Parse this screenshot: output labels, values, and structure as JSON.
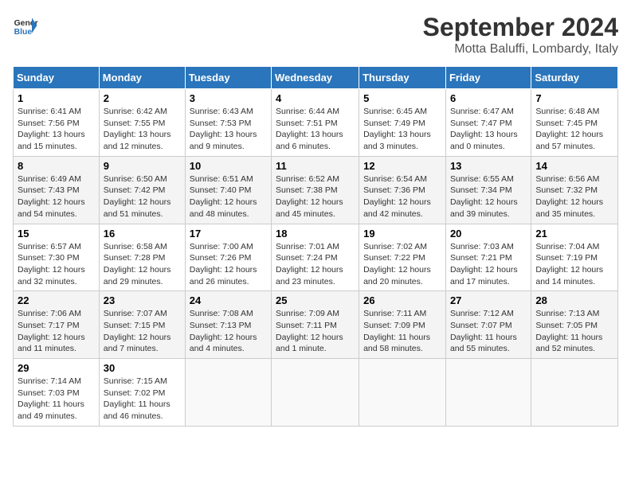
{
  "header": {
    "logo_line1": "General",
    "logo_line2": "Blue",
    "month": "September 2024",
    "location": "Motta Baluffi, Lombardy, Italy"
  },
  "columns": [
    "Sunday",
    "Monday",
    "Tuesday",
    "Wednesday",
    "Thursday",
    "Friday",
    "Saturday"
  ],
  "weeks": [
    [
      {
        "day": "1",
        "info": "Sunrise: 6:41 AM\nSunset: 7:56 PM\nDaylight: 13 hours\nand 15 minutes."
      },
      {
        "day": "2",
        "info": "Sunrise: 6:42 AM\nSunset: 7:55 PM\nDaylight: 13 hours\nand 12 minutes."
      },
      {
        "day": "3",
        "info": "Sunrise: 6:43 AM\nSunset: 7:53 PM\nDaylight: 13 hours\nand 9 minutes."
      },
      {
        "day": "4",
        "info": "Sunrise: 6:44 AM\nSunset: 7:51 PM\nDaylight: 13 hours\nand 6 minutes."
      },
      {
        "day": "5",
        "info": "Sunrise: 6:45 AM\nSunset: 7:49 PM\nDaylight: 13 hours\nand 3 minutes."
      },
      {
        "day": "6",
        "info": "Sunrise: 6:47 AM\nSunset: 7:47 PM\nDaylight: 13 hours\nand 0 minutes."
      },
      {
        "day": "7",
        "info": "Sunrise: 6:48 AM\nSunset: 7:45 PM\nDaylight: 12 hours\nand 57 minutes."
      }
    ],
    [
      {
        "day": "8",
        "info": "Sunrise: 6:49 AM\nSunset: 7:43 PM\nDaylight: 12 hours\nand 54 minutes."
      },
      {
        "day": "9",
        "info": "Sunrise: 6:50 AM\nSunset: 7:42 PM\nDaylight: 12 hours\nand 51 minutes."
      },
      {
        "day": "10",
        "info": "Sunrise: 6:51 AM\nSunset: 7:40 PM\nDaylight: 12 hours\nand 48 minutes."
      },
      {
        "day": "11",
        "info": "Sunrise: 6:52 AM\nSunset: 7:38 PM\nDaylight: 12 hours\nand 45 minutes."
      },
      {
        "day": "12",
        "info": "Sunrise: 6:54 AM\nSunset: 7:36 PM\nDaylight: 12 hours\nand 42 minutes."
      },
      {
        "day": "13",
        "info": "Sunrise: 6:55 AM\nSunset: 7:34 PM\nDaylight: 12 hours\nand 39 minutes."
      },
      {
        "day": "14",
        "info": "Sunrise: 6:56 AM\nSunset: 7:32 PM\nDaylight: 12 hours\nand 35 minutes."
      }
    ],
    [
      {
        "day": "15",
        "info": "Sunrise: 6:57 AM\nSunset: 7:30 PM\nDaylight: 12 hours\nand 32 minutes."
      },
      {
        "day": "16",
        "info": "Sunrise: 6:58 AM\nSunset: 7:28 PM\nDaylight: 12 hours\nand 29 minutes."
      },
      {
        "day": "17",
        "info": "Sunrise: 7:00 AM\nSunset: 7:26 PM\nDaylight: 12 hours\nand 26 minutes."
      },
      {
        "day": "18",
        "info": "Sunrise: 7:01 AM\nSunset: 7:24 PM\nDaylight: 12 hours\nand 23 minutes."
      },
      {
        "day": "19",
        "info": "Sunrise: 7:02 AM\nSunset: 7:22 PM\nDaylight: 12 hours\nand 20 minutes."
      },
      {
        "day": "20",
        "info": "Sunrise: 7:03 AM\nSunset: 7:21 PM\nDaylight: 12 hours\nand 17 minutes."
      },
      {
        "day": "21",
        "info": "Sunrise: 7:04 AM\nSunset: 7:19 PM\nDaylight: 12 hours\nand 14 minutes."
      }
    ],
    [
      {
        "day": "22",
        "info": "Sunrise: 7:06 AM\nSunset: 7:17 PM\nDaylight: 12 hours\nand 11 minutes."
      },
      {
        "day": "23",
        "info": "Sunrise: 7:07 AM\nSunset: 7:15 PM\nDaylight: 12 hours\nand 7 minutes."
      },
      {
        "day": "24",
        "info": "Sunrise: 7:08 AM\nSunset: 7:13 PM\nDaylight: 12 hours\nand 4 minutes."
      },
      {
        "day": "25",
        "info": "Sunrise: 7:09 AM\nSunset: 7:11 PM\nDaylight: 12 hours\nand 1 minute."
      },
      {
        "day": "26",
        "info": "Sunrise: 7:11 AM\nSunset: 7:09 PM\nDaylight: 11 hours\nand 58 minutes."
      },
      {
        "day": "27",
        "info": "Sunrise: 7:12 AM\nSunset: 7:07 PM\nDaylight: 11 hours\nand 55 minutes."
      },
      {
        "day": "28",
        "info": "Sunrise: 7:13 AM\nSunset: 7:05 PM\nDaylight: 11 hours\nand 52 minutes."
      }
    ],
    [
      {
        "day": "29",
        "info": "Sunrise: 7:14 AM\nSunset: 7:03 PM\nDaylight: 11 hours\nand 49 minutes."
      },
      {
        "day": "30",
        "info": "Sunrise: 7:15 AM\nSunset: 7:02 PM\nDaylight: 11 hours\nand 46 minutes."
      },
      {
        "day": "",
        "info": ""
      },
      {
        "day": "",
        "info": ""
      },
      {
        "day": "",
        "info": ""
      },
      {
        "day": "",
        "info": ""
      },
      {
        "day": "",
        "info": ""
      }
    ]
  ]
}
